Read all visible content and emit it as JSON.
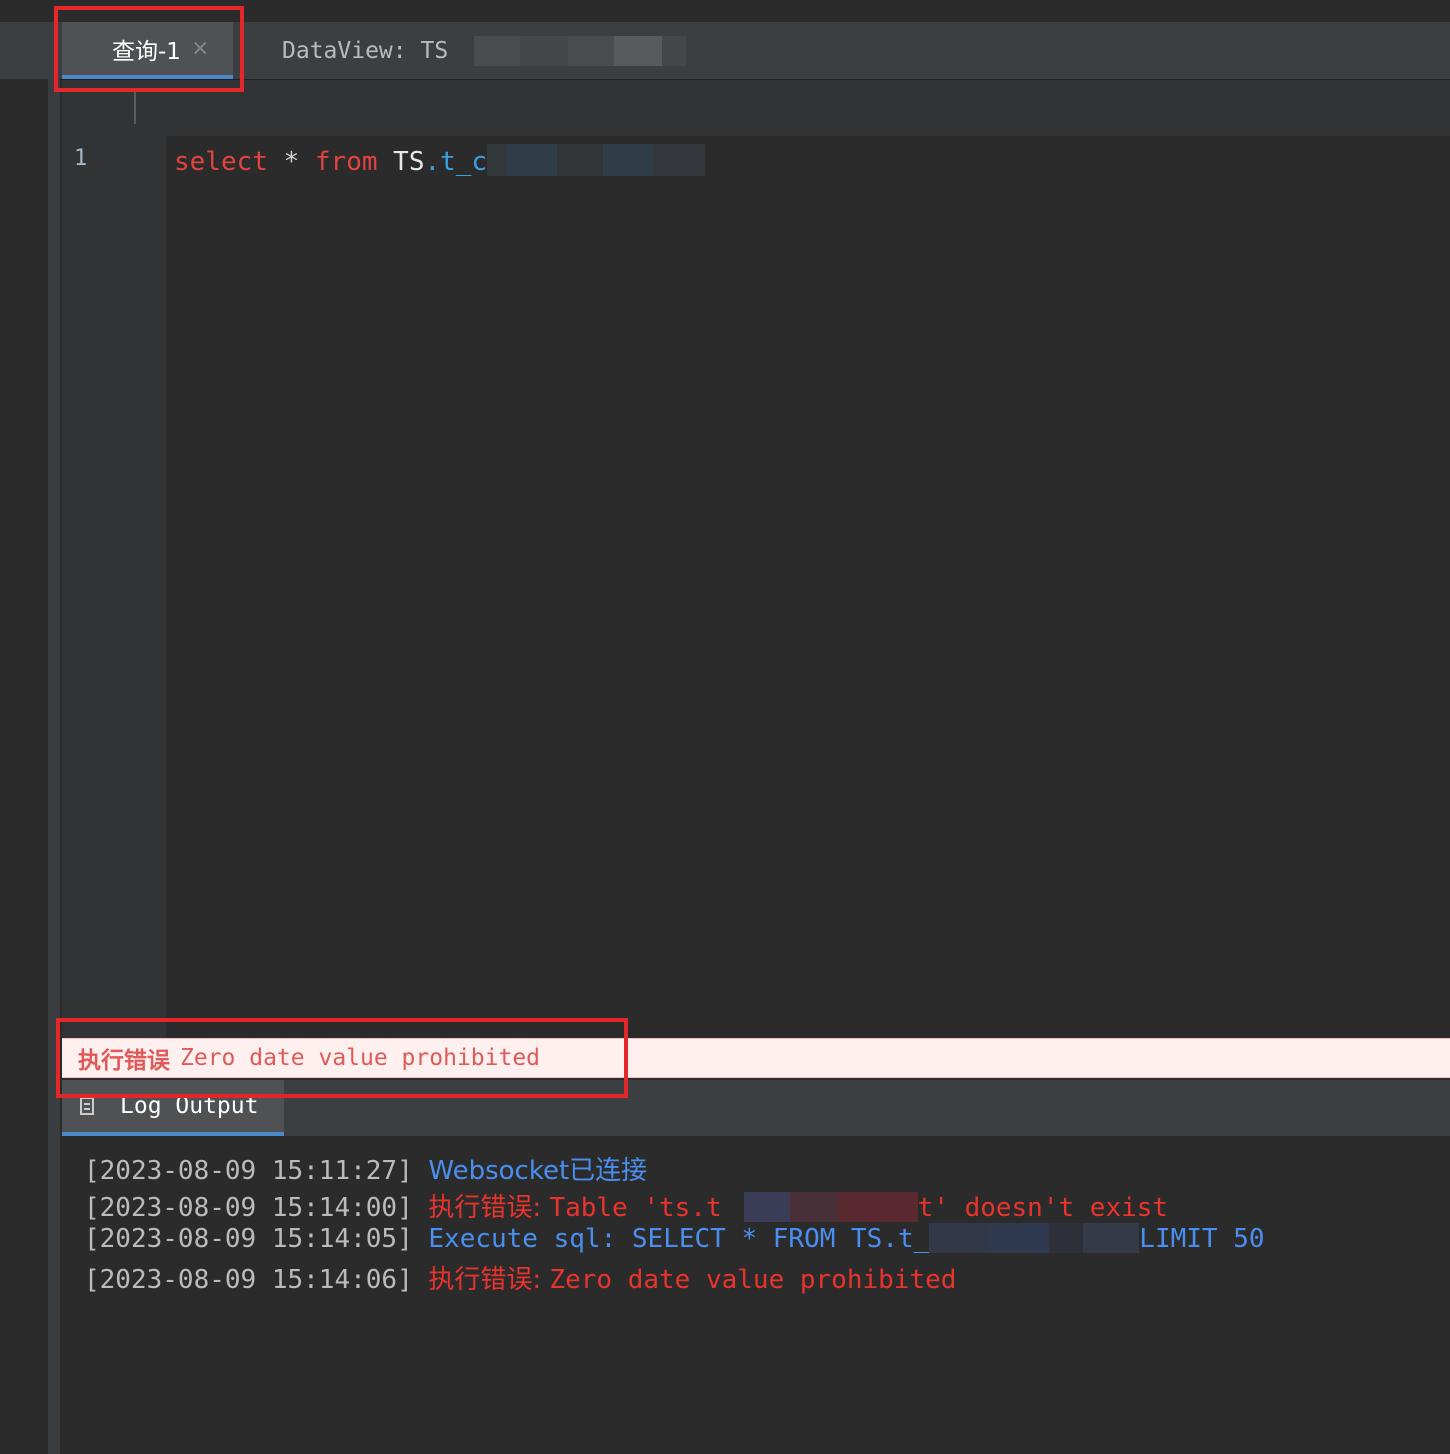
{
  "tabs": [
    {
      "label": "查询-1",
      "close": "×",
      "active": true
    },
    {
      "label": "DataView: TS",
      "active": false
    }
  ],
  "editor": {
    "line_number": "1",
    "code": {
      "kw1": "select",
      "star": " * ",
      "kw2": "from",
      "schema": " TS",
      "table": ".t_c"
    }
  },
  "error_bar": {
    "label": "执行错误",
    "message": "Zero date value prohibited"
  },
  "log_panel": {
    "tab_label": "Log Output",
    "lines": [
      {
        "time": "[2023-08-09 15:11:27]",
        "text": "Websocket已连接",
        "level": "info"
      },
      {
        "time": "[2023-08-09 15:14:00]",
        "text_prefix": "执行错误: ",
        "text": "Table 'ts.t",
        "text_suffix": "t' doesn't exist",
        "level": "error"
      },
      {
        "time": "[2023-08-09 15:14:05]",
        "text": "Execute sql: SELECT * FROM TS.t_",
        "text_suffix": "LIMIT 50",
        "level": "info"
      },
      {
        "time": "[2023-08-09 15:14:06]",
        "text_prefix": "执行错误: ",
        "text": "Zero date value prohibited",
        "level": "error"
      }
    ]
  },
  "colors": {
    "accent": "#4a88c7",
    "error": "#e8342c",
    "info": "#4a8ff0",
    "highlight_box": "#e5262a"
  }
}
